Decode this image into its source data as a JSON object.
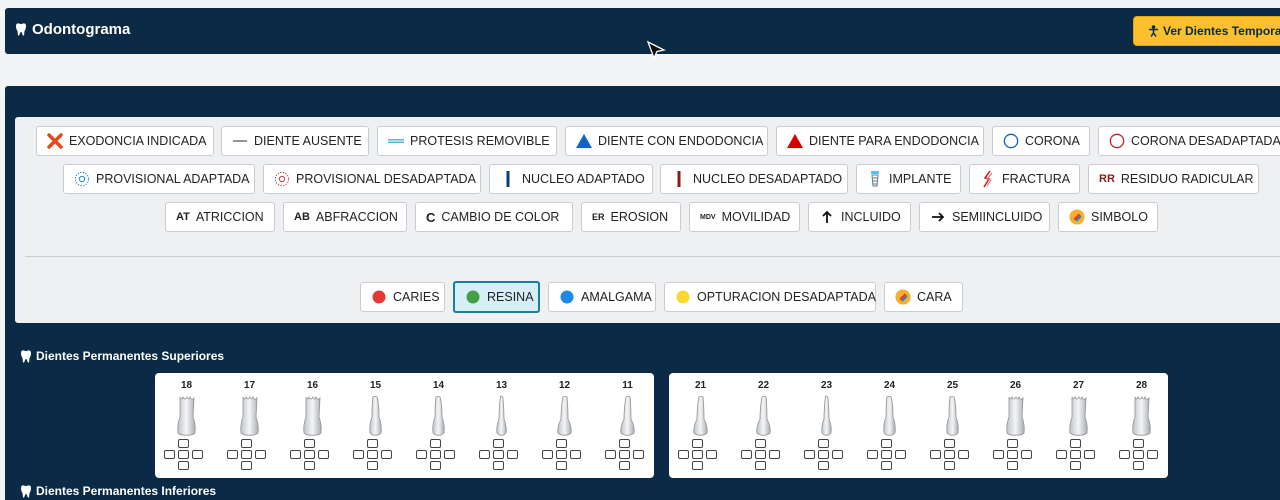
{
  "header": {
    "title": "Odontograma",
    "temp_button": "Ver Dientes Tempora"
  },
  "legend": {
    "row1": [
      {
        "label": "EXODONCIA INDICADA",
        "icon": "x-mark-icon"
      },
      {
        "label": "DIENTE AUSENTE",
        "icon": "gray-line-icon"
      },
      {
        "label": "PROTESIS REMOVIBLE",
        "icon": "double-line-icon"
      },
      {
        "label": "DIENTE CON ENDODONCIA",
        "icon": "blue-triangle-icon"
      },
      {
        "label": "DIENTE PARA ENDODONCIA",
        "icon": "red-triangle-icon"
      },
      {
        "label": "CORONA",
        "icon": "blue-circle-icon"
      },
      {
        "label": "CORONA DESADAPTADA",
        "icon": "red-circle-icon"
      }
    ],
    "row2": [
      {
        "label": "PROVISIONAL ADAPTADA",
        "icon": "blue-dotted-circle-icon"
      },
      {
        "label": "PROVISIONAL DESADAPTADA",
        "icon": "red-dotted-circle-icon"
      },
      {
        "label": "NUCLEO ADAPTADO",
        "icon": "blue-bar-icon"
      },
      {
        "label": "NUCLEO DESADAPTADO",
        "icon": "red-bar-icon"
      },
      {
        "label": "IMPLANTE",
        "icon": "implant-icon"
      },
      {
        "label": "FRACTURA",
        "icon": "fracture-icon"
      },
      {
        "label": "RESIDUO RADICULAR",
        "icon": "rr-text-icon",
        "icon_text": "RR"
      }
    ],
    "row3": [
      {
        "label": "ATRICCION",
        "icon": "at-text-icon",
        "icon_text": "AT"
      },
      {
        "label": "ABFRACCION",
        "icon": "ab-text-icon",
        "icon_text": "AB"
      },
      {
        "label": "CAMBIO DE COLOR",
        "icon": "c-text-icon",
        "icon_text": "C"
      },
      {
        "label": "EROSION",
        "icon": "er-text-icon",
        "icon_text": "ER"
      },
      {
        "label": "MOVILIDAD",
        "icon": "mdv-text-icon",
        "icon_text": "MDV"
      },
      {
        "label": "INCLUIDO",
        "icon": "arrow-up-icon"
      },
      {
        "label": "SEMIINCLUIDO",
        "icon": "arrow-right-icon"
      },
      {
        "label": "SIMBOLO",
        "icon": "symbol-icon"
      }
    ],
    "row4": [
      {
        "label": "CARIES",
        "icon": "red-dot-icon"
      },
      {
        "label": "RESINA",
        "icon": "green-dot-icon",
        "active": true
      },
      {
        "label": "AMALGAMA",
        "icon": "blue-dot-icon"
      },
      {
        "label": "OPTURACION DESADAPTADA",
        "icon": "yellow-dot-icon"
      },
      {
        "label": "CARA",
        "icon": "symbol-icon"
      }
    ]
  },
  "colors": {
    "navy": "#0b2a45",
    "yellow": "#fbc02d",
    "red": "#e53935",
    "blue": "#1565c0",
    "green": "#43a047",
    "teal": "#1a7f9c"
  },
  "upper_section": {
    "title": "Dientes Permanentes Superiores",
    "right_quadrant": [
      "18",
      "17",
      "16",
      "15",
      "14",
      "13",
      "12",
      "11"
    ],
    "left_quadrant": [
      "21",
      "22",
      "23",
      "24",
      "25",
      "26",
      "27",
      "28"
    ]
  },
  "lower_section": {
    "title": "Dientes Permanentes Inferiores"
  }
}
